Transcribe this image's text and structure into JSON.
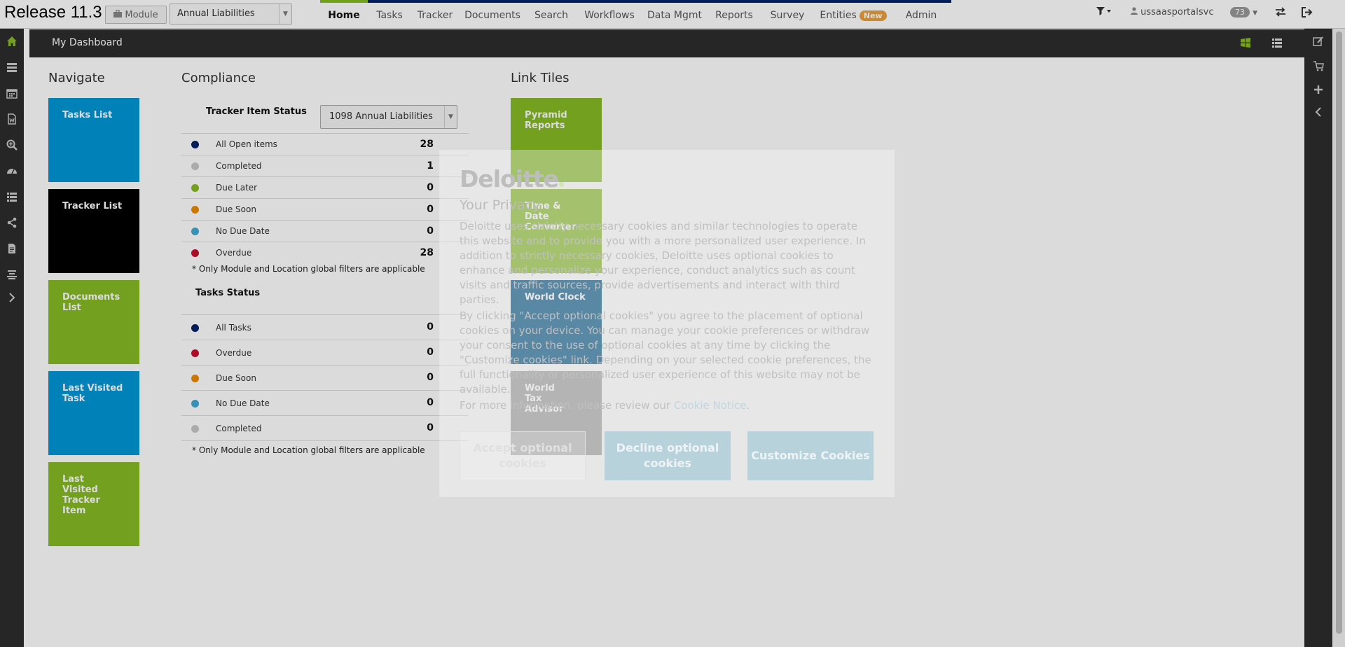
{
  "topbar": {
    "release": "Release 11.3",
    "module_label": "Module",
    "module_value": "Annual Liabilities",
    "nav": [
      {
        "label": "Home",
        "active": true
      },
      {
        "label": "Tasks"
      },
      {
        "label": "Tracker"
      },
      {
        "label": "Documents"
      },
      {
        "label": "Search"
      },
      {
        "label": "Workflows"
      },
      {
        "label": "Data Mgmt"
      },
      {
        "label": "Reports"
      },
      {
        "label": "Survey"
      },
      {
        "label": "Entities",
        "badge": "New"
      },
      {
        "label": "Admin"
      }
    ],
    "username": "ussaasportalsvc",
    "notification_count": "73"
  },
  "dashboard": {
    "title": "My Dashboard"
  },
  "navigate": {
    "title": "Navigate",
    "tiles": [
      {
        "label": "Tasks List",
        "color": "#0097d7"
      },
      {
        "label": "Tracker List",
        "color": "#000000"
      },
      {
        "label": "Documents List",
        "color": "#86bc25"
      },
      {
        "label": "Last Visited Task",
        "color": "#0097d7"
      },
      {
        "label": "Last Visited Tracker Item",
        "color": "#86bc25"
      }
    ]
  },
  "compliance": {
    "title": "Compliance",
    "tracker_status_label": "Tracker Item Status",
    "tracker_select_value": "1098 Annual Liabilities",
    "tracker_rows": [
      {
        "label": "All Open items",
        "value": "28",
        "color": "#012169"
      },
      {
        "label": "Completed",
        "value": "1",
        "color": "#c8c8c8"
      },
      {
        "label": "Due Later",
        "value": "0",
        "color": "#86bc25"
      },
      {
        "label": "Due Soon",
        "value": "0",
        "color": "#ed8b00"
      },
      {
        "label": "No Due Date",
        "value": "0",
        "color": "#3fa9d5"
      },
      {
        "label": "Overdue",
        "value": "28",
        "color": "#c8102e"
      }
    ],
    "footnote": "* Only Module and Location global filters are applicable",
    "tasks_status_label": "Tasks Status",
    "task_rows": [
      {
        "label": "All Tasks",
        "value": "0",
        "color": "#012169"
      },
      {
        "label": "Overdue",
        "value": "0",
        "color": "#c8102e"
      },
      {
        "label": "Due Soon",
        "value": "0",
        "color": "#ed8b00"
      },
      {
        "label": "No Due Date",
        "value": "0",
        "color": "#3fa9d5"
      },
      {
        "label": "Completed",
        "value": "0",
        "color": "#c8c8c8"
      }
    ],
    "tasks_footnote": "* Only Module and Location global filters are applicable"
  },
  "link_tiles": {
    "title": "Link Tiles",
    "tiles": [
      {
        "label": "Pyramid Reports",
        "color": "#86bc25"
      },
      {
        "label": "Time & Date Converter",
        "color": "#86bc25"
      },
      {
        "label": "World Clock",
        "color": "#005587"
      },
      {
        "label": "World Tax Advisor",
        "color": "#a5a5a5"
      }
    ]
  },
  "cookie_banner": {
    "brand": "Deloitte",
    "heading": "Your Privacy",
    "para1": "Deloitte uses strictly necessary cookies and similar technologies to operate this website and to provide you with a more personalized user experience. In addition to strictly necessary cookies, Deloitte uses optional cookies to enhance and personalize your experience, conduct analytics such as count visits and traffic sources, provide advertisements and interact with third parties.",
    "para2": "By clicking \"Accept optional cookies\" you agree to the placement of optional cookies on your device. You can manage your cookie preferences or withdraw your consent to the use of optional cookies at any time by clicking the \"Customize cookies\" link. Depending on your selected cookie preferences, the full functionality or personalized user experience of this website may not be available.",
    "para3_prefix": "For more information, please review our ",
    "para3_link": "Cookie Notice",
    "para3_suffix": ".",
    "accept_label": "Accept optional cookies",
    "decline_label": "Decline optional cookies",
    "customize_label": "Customize Cookies"
  }
}
